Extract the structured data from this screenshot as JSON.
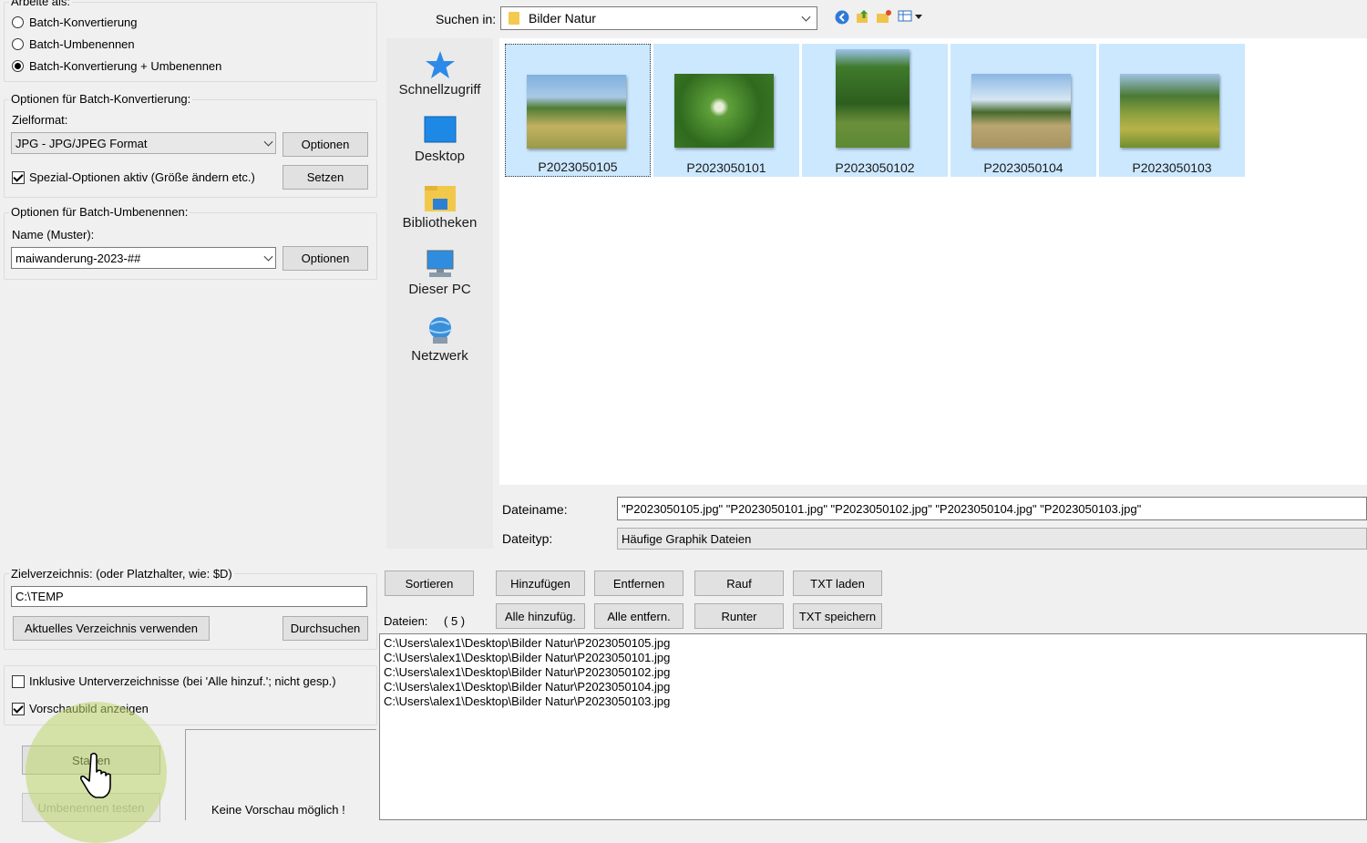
{
  "work_as": {
    "title": "Arbeite als:",
    "options": [
      {
        "label": "Batch-Konvertierung",
        "checked": false
      },
      {
        "label": "Batch-Umbenennen",
        "checked": false
      },
      {
        "label": "Batch-Konvertierung + Umbenennen",
        "checked": true
      }
    ]
  },
  "conversion": {
    "title": "Optionen für Batch-Konvertierung:",
    "format_label": "Zielformat:",
    "format_value": "JPG - JPG/JPEG Format",
    "options_button": "Optionen",
    "special_label": "Spezial-Optionen aktiv (Größe ändern etc.)",
    "special_checked": true,
    "set_button": "Setzen"
  },
  "rename": {
    "title": "Optionen für Batch-Umbenennen:",
    "name_label": "Name (Muster):",
    "name_value": "maiwanderung-2023-##",
    "options_button": "Optionen"
  },
  "target": {
    "title": "Zielverzeichnis: (oder Platzhalter, wie: $D)",
    "path": "C:\\TEMP",
    "use_current_button": "Aktuelles Verzeichnis verwenden",
    "browse_button": "Durchsuchen"
  },
  "include_subdirs": {
    "label": "Inklusive Unterverzeichnisse (bei 'Alle hinzuf.'; nicht gesp.)",
    "checked": false
  },
  "show_preview": {
    "label": "Vorschaubild anzeigen",
    "checked": true
  },
  "start_button": "Starten",
  "test_rename_button": "Umbenennen testen",
  "preview_text": "Keine Vorschau möglich !",
  "browser": {
    "look_in_label": "Suchen in:",
    "look_in_value": "Bilder Natur",
    "places": [
      {
        "label": "Schnellzugriff",
        "icon": "star-icon"
      },
      {
        "label": "Desktop",
        "icon": "desktop-icon"
      },
      {
        "label": "Bibliotheken",
        "icon": "libraries-icon"
      },
      {
        "label": "Dieser PC",
        "icon": "computer-icon"
      },
      {
        "label": "Netzwerk",
        "icon": "network-icon"
      }
    ],
    "files": [
      {
        "name": "P2023050105",
        "focused": true
      },
      {
        "name": "P2023050101",
        "focused": false
      },
      {
        "name": "P2023050102",
        "focused": false
      },
      {
        "name": "P2023050104",
        "focused": false
      },
      {
        "name": "P2023050103",
        "focused": false
      }
    ],
    "filename_label": "Dateiname:",
    "filename_value": "\"P2023050105.jpg\" \"P2023050101.jpg\" \"P2023050102.jpg\" \"P2023050104.jpg\" \"P2023050103.jpg\"",
    "filetype_label": "Dateityp:",
    "filetype_value": "Häufige Graphik Dateien"
  },
  "list_buttons": {
    "sort": "Sortieren",
    "add": "Hinzufügen",
    "remove": "Entfernen",
    "up": "Rauf",
    "load_txt": "TXT laden",
    "add_all": "Alle hinzufüg.",
    "remove_all": "Alle entfern.",
    "down": "Runter",
    "save_txt": "TXT speichern"
  },
  "files_label": "Dateien:",
  "files_count": "( 5 )",
  "file_list": [
    "C:\\Users\\alex1\\Desktop\\Bilder Natur\\P2023050105.jpg",
    "C:\\Users\\alex1\\Desktop\\Bilder Natur\\P2023050101.jpg",
    "C:\\Users\\alex1\\Desktop\\Bilder Natur\\P2023050102.jpg",
    "C:\\Users\\alex1\\Desktop\\Bilder Natur\\P2023050104.jpg",
    "C:\\Users\\alex1\\Desktop\\Bilder Natur\\P2023050103.jpg"
  ]
}
